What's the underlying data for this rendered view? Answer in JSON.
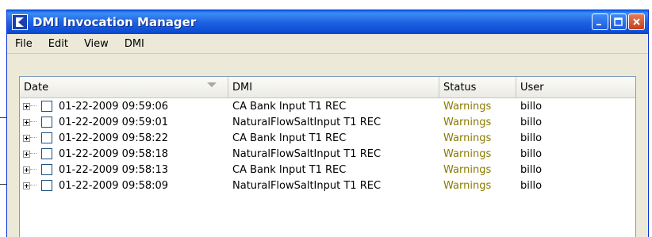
{
  "window": {
    "title": "DMI Invocation Manager"
  },
  "menu": [
    "File",
    "Edit",
    "View",
    "DMI"
  ],
  "table": {
    "columns": [
      "Date",
      "DMI",
      "Status",
      "User"
    ],
    "rows": [
      {
        "date": "01-22-2009 09:59:06",
        "dmi": "CA Bank Input T1 REC",
        "status": "Warnings",
        "user": "billo"
      },
      {
        "date": "01-22-2009 09:59:01",
        "dmi": "NaturalFlowSaltInput T1 REC",
        "status": "Warnings",
        "user": "billo"
      },
      {
        "date": "01-22-2009 09:58:22",
        "dmi": "CA Bank Input T1 REC",
        "status": "Warnings",
        "user": "billo"
      },
      {
        "date": "01-22-2009 09:58:18",
        "dmi": "NaturalFlowSaltInput T1 REC",
        "status": "Warnings",
        "user": "billo"
      },
      {
        "date": "01-22-2009 09:58:13",
        "dmi": "CA Bank Input T1 REC",
        "status": "Warnings",
        "user": "billo"
      },
      {
        "date": "01-22-2009 09:58:09",
        "dmi": "NaturalFlowSaltInput T1 REC",
        "status": "Warnings",
        "user": "billo"
      }
    ]
  },
  "colors": {
    "titlebar": "#1f62e2",
    "status_warning": "#8a7a00"
  },
  "icons": {
    "app": "app-logo-icon",
    "minimize": "minimize-icon",
    "maximize": "maximize-icon",
    "close": "close-icon"
  }
}
